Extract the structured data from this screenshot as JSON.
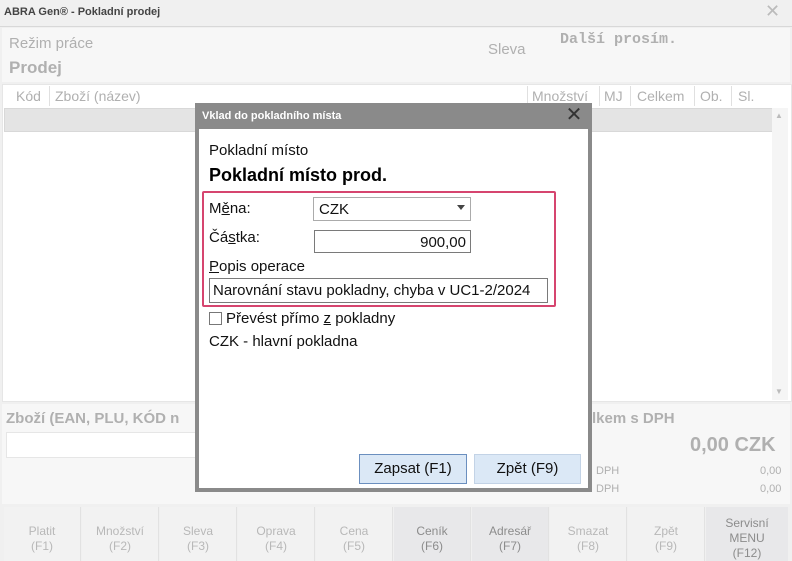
{
  "window": {
    "title": "ABRA Gen® - Pokladní prodej",
    "close_glyph": "✕"
  },
  "mode": {
    "label": "Režim práce",
    "value": "Prodej"
  },
  "discount_label": "Sleva",
  "display_text": "Další prosím.",
  "columns": {
    "code": "Kód",
    "item": "Zboží (název)",
    "qty": "Množství",
    "unit": "MJ",
    "total": "Celkem",
    "ob": "Ob.",
    "sl": "Sl."
  },
  "lower": {
    "scan_label": "Zboží (EAN, PLU, KÓD n",
    "total_label": "lkem s DPH",
    "total_value": "0,00 CZK",
    "dph_label": "DPH",
    "dph_value": "0,00",
    "bez_label": "DPH",
    "bez_value": "0,00"
  },
  "function_keys": [
    {
      "label": "Platit",
      "key": "(F1)"
    },
    {
      "label": "Množství",
      "key": "(F2)"
    },
    {
      "label": "Sleva",
      "key": "(F3)"
    },
    {
      "label": "Oprava",
      "key": "(F4)"
    },
    {
      "label": "Cena",
      "key": "(F5)"
    },
    {
      "label": "Ceník",
      "key": "(F6)"
    },
    {
      "label": "Adresář",
      "key": "(F7)"
    },
    {
      "label": "Smazat",
      "key": "(F8)"
    },
    {
      "label": "Zpět",
      "key": "(F9)"
    },
    {
      "label": "Servisní",
      "label2": "MENU",
      "key": "(F12)"
    }
  ],
  "dialog": {
    "title": "Vklad do pokladního místa",
    "place_label": "Pokladní místo",
    "place_value": "Pokladní místo prod.",
    "currency_label_pre": "M",
    "currency_label_ul": "ě",
    "currency_label_post": "na:",
    "currency_value": "CZK",
    "amount_label_pre": "Čá",
    "amount_label_ul": "s",
    "amount_label_post": "tka:",
    "amount_value": "900,00",
    "desc_label_ul": "P",
    "desc_label_post": "opis operace",
    "desc_value": "Narovnání stavu pokladny, chyba v UC1-2/2024",
    "transfer_label_pre": "Převést přímo ",
    "transfer_label_ul": "z",
    "transfer_label_post": " pokladny",
    "transfer_checked": false,
    "cash_desk": "CZK - hlavní pokladna",
    "save_button": "Zapsat (F1)",
    "back_button": "Zpět (F9)"
  }
}
